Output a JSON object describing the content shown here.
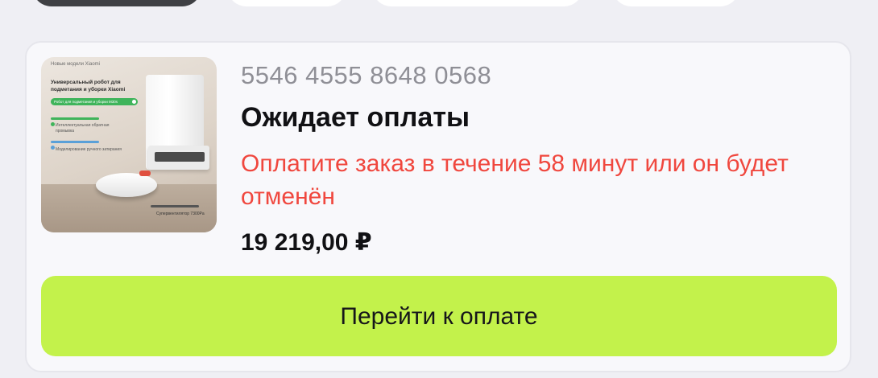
{
  "order": {
    "number": "5546 4555 8648 0568",
    "status": "Ожидает оплаты",
    "warning": "Оплатите заказ в течение 58 минут или он будет отменён",
    "price": "19 219,00 ₽",
    "pay_button_label": "Перейти к оплате",
    "status_color": "#f0473e",
    "button_color": "#c3f24b"
  },
  "product_image": {
    "brand_line": "Новые модели Xiaomi",
    "title": "Универсальный робот для подметания и уборки Xiaomi",
    "pill": "Робот для подметания и уборки M30s",
    "features": [
      "Интеллектуальная обратная промывка",
      "Моделирование ручного затирания"
    ],
    "caption": "Супервентилятор 7300Pa"
  }
}
